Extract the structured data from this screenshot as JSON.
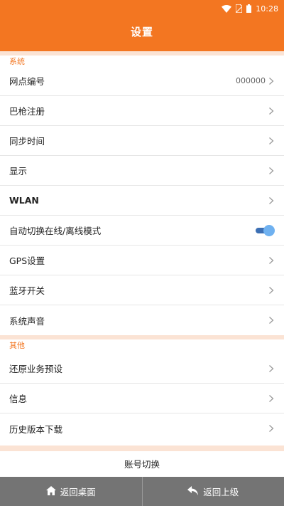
{
  "status_bar": {
    "time": "10:28",
    "icons": [
      "wifi-icon",
      "sim-icon",
      "battery-icon"
    ]
  },
  "header": {
    "title": "设置"
  },
  "sections": {
    "system": {
      "label": "系统",
      "items": [
        {
          "label": "网点编号",
          "value": "000000",
          "control": "chevron"
        },
        {
          "label": "巴枪注册",
          "control": "chevron"
        },
        {
          "label": "同步时间",
          "control": "chevron"
        },
        {
          "label": "显示",
          "control": "chevron"
        },
        {
          "label": "WLAN",
          "control": "chevron"
        },
        {
          "label": "自动切换在线/离线模式",
          "control": "toggle",
          "toggle_on": true
        },
        {
          "label": "GPS设置",
          "control": "chevron"
        },
        {
          "label": "蓝牙开关",
          "control": "chevron"
        },
        {
          "label": "系统声音",
          "control": "chevron"
        }
      ]
    },
    "other": {
      "label": "其他",
      "items": [
        {
          "label": "还原业务预设",
          "control": "chevron"
        },
        {
          "label": "信息",
          "control": "chevron"
        },
        {
          "label": "历史版本下载",
          "control": "chevron"
        }
      ]
    }
  },
  "account_switch": {
    "label": "账号切换"
  },
  "bottom_nav": {
    "home_label": "返回桌面",
    "back_label": "返回上级"
  },
  "colors": {
    "accent": "#f37621",
    "section_gap": "#fbe3d4",
    "toggle_track": "#3c6fb4",
    "toggle_knob": "#6fb1f0",
    "bottom_bar": "#747474"
  }
}
